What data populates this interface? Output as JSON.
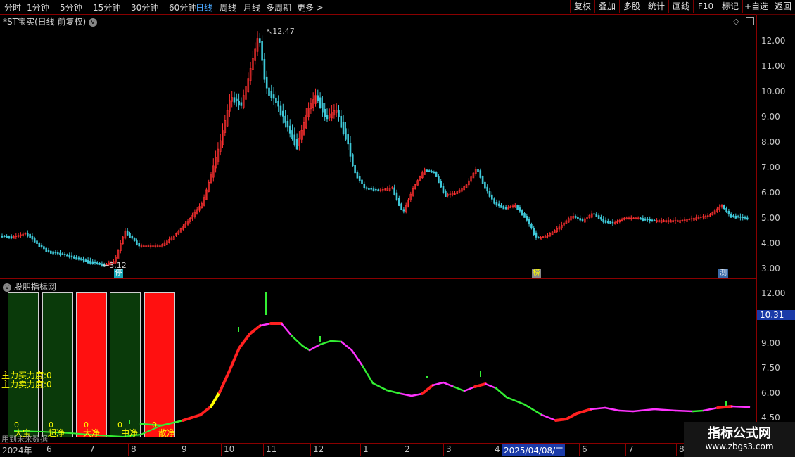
{
  "toolbar": {
    "periods": [
      "分时",
      "1分钟",
      "5分钟",
      "15分钟",
      "30分钟",
      "60分钟",
      "日线",
      "周线",
      "月线",
      "多周期",
      "更多 >"
    ],
    "active_period": "日线",
    "buttons": [
      "复权",
      "叠加",
      "多股",
      "统计",
      "画线",
      "F10",
      "标记",
      "+自选",
      "返回"
    ]
  },
  "main_chart": {
    "title": "*ST宝实(日线 前复权)",
    "high_label": "12.47",
    "low_label": "3.12",
    "y_ticks": [
      "12.00",
      "11.00",
      "10.00",
      "9.00",
      "8.00",
      "7.00",
      "6.00",
      "5.00",
      "4.00",
      "3.00"
    ],
    "markers": [
      "停",
      "榜",
      "测"
    ]
  },
  "indicator": {
    "title": "股朋指标网",
    "y_ticks": [
      "12.00",
      "10.31",
      "9.00",
      "7.50",
      "6.00",
      "4.50"
    ],
    "current_value": "10.31",
    "strength_label_1": "主力买力度:0",
    "strength_label_2": "主力卖力度:0",
    "panels": [
      {
        "label": "大宝",
        "value": "0",
        "color": "#0a3a0a"
      },
      {
        "label": "超净",
        "value": "0",
        "color": "#0a3a0a"
      },
      {
        "label": "大净",
        "value": "0",
        "color": "#ff1010"
      },
      {
        "label": "中净",
        "value": "0",
        "color": "#0a3a0a"
      },
      {
        "label": "散净",
        "value": "0",
        "color": "#ff1010"
      }
    ],
    "footer_text": "用到未来数据"
  },
  "x_axis": {
    "labels": [
      "2024年",
      "6",
      "7",
      "8",
      "9",
      "10",
      "11",
      "12",
      "1",
      "2",
      "3",
      "4",
      "2025/04/08/二",
      "6",
      "7",
      "8"
    ],
    "highlight": "2025/04/08/二"
  },
  "watermark": {
    "line1": "指标公式网",
    "line2": "www.zbgs3.com"
  },
  "colors": {
    "up": "#ff3030",
    "down": "#3fc8d8",
    "line_green": "#33ee33",
    "line_magenta": "#ff33ff",
    "line_yellow": "#ffff00",
    "line_red": "#ff2020",
    "grid": "#8a0000"
  }
}
